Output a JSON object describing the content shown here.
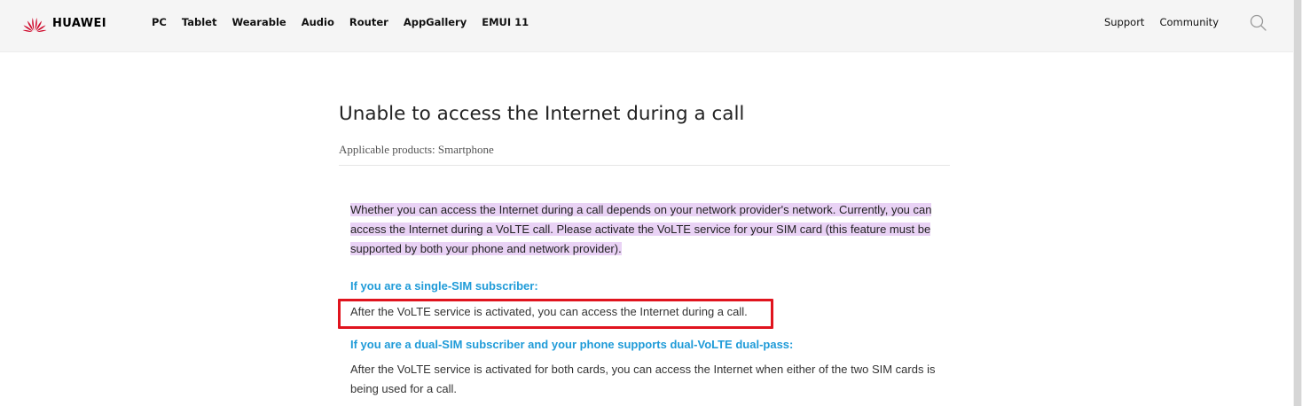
{
  "brand": {
    "name": "HUAWEI",
    "color": "#cf0a2c"
  },
  "nav": {
    "items": [
      "PC",
      "Tablet",
      "Wearable",
      "Audio",
      "Router",
      "AppGallery",
      "EMUI 11"
    ],
    "right": {
      "support": "Support",
      "community": "Community"
    },
    "search_icon": "search-icon"
  },
  "article": {
    "title": "Unable to access the Internet during a call",
    "applicable_label": "Applicable products:",
    "applicable_value": "Smartphone",
    "intro": "Whether you can access the Internet during a call depends on your network provider's network. Currently, you can access the Internet during a VoLTE call. Please activate the VoLTE service for your SIM card (this feature must be supported by both your phone and network provider).",
    "single_sim_heading": "If you are a single-SIM subscriber:",
    "single_sim_text": "After the VoLTE service is activated, you can access the Internet during a call.",
    "dual_sim_heading": "If you are a dual-SIM subscriber and your phone supports dual-VoLTE dual-pass:",
    "dual_sim_text": "After the VoLTE service is activated for both cards, you can access the Internet when either of the two SIM cards is being used for a call."
  },
  "colors": {
    "heading_blue": "#1f9bd8",
    "highlight": "#e9d2f5",
    "annotation_red": "#e0141e"
  }
}
